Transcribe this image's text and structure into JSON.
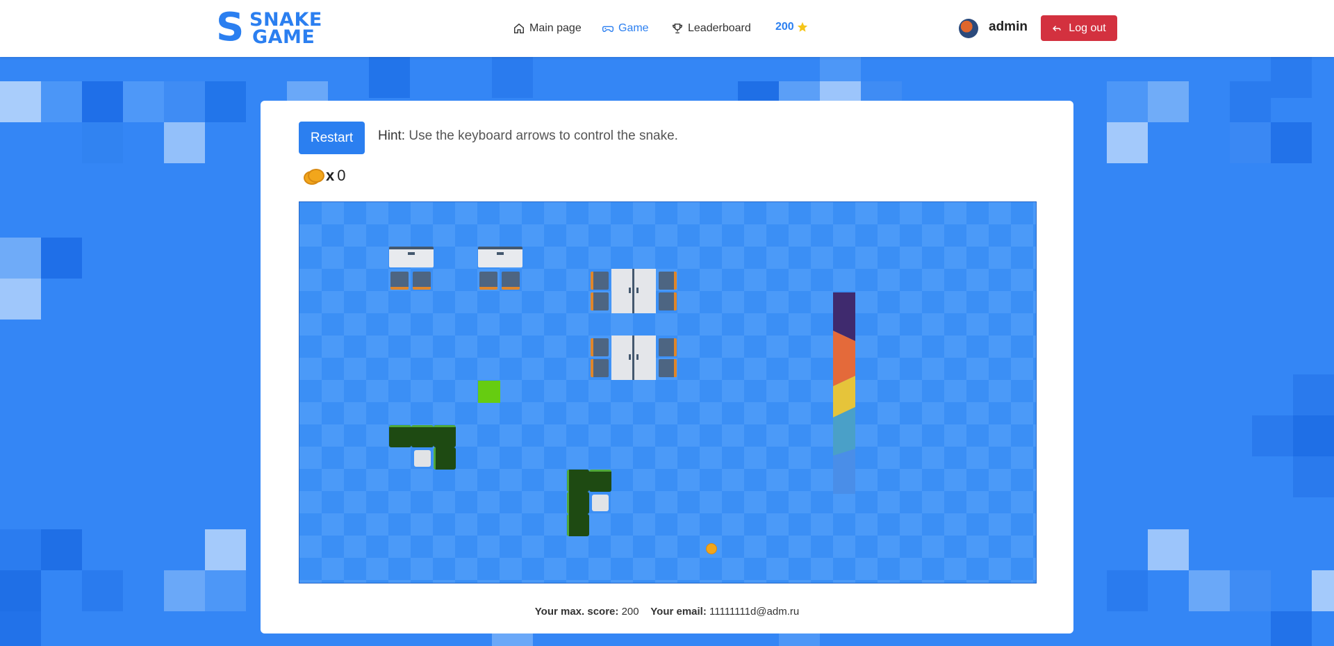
{
  "header": {
    "logo_top": "SNAKE",
    "logo_bottom": "GAME",
    "nav": [
      {
        "label": "Main page",
        "icon": "home-icon"
      },
      {
        "label": "Game",
        "icon": "gamepad-icon"
      },
      {
        "label": "Leaderboard",
        "icon": "trophy-icon"
      }
    ],
    "score": "200",
    "username": "admin",
    "logout_label": "Log out"
  },
  "game": {
    "restart_label": "Restart",
    "hint_label": "Hint:",
    "hint_text": "Use the keyboard arrows to control the snake.",
    "coin_multiplier": "x",
    "coin_count": "0"
  },
  "footer": {
    "max_score_label": "Your max. score:",
    "max_score_value": "200",
    "email_label": "Your email:",
    "email_value": "11111111d@adm.ru"
  },
  "colors": {
    "accent": "#2b7ff0",
    "logout": "#d3313f",
    "board": "#3b8ff5",
    "snake": "#1e4a12",
    "food": "#66cc11",
    "coin": "#f2a61c"
  }
}
